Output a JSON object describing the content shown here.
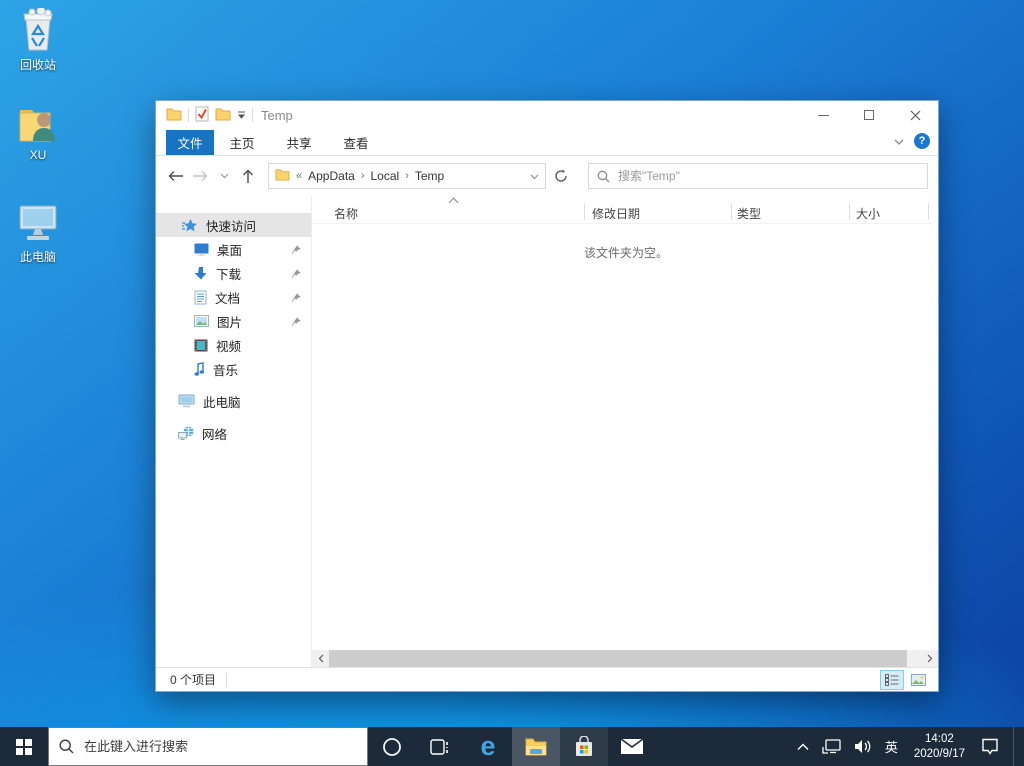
{
  "desktop": {
    "icons": [
      {
        "label": "回收站",
        "icon": "recycle-bin"
      },
      {
        "label": "XU",
        "icon": "user-folder"
      },
      {
        "label": "此电脑",
        "icon": "this-pc"
      }
    ]
  },
  "explorer": {
    "title": "Temp",
    "tabs": [
      {
        "label": "文件",
        "active": true
      },
      {
        "label": "主页",
        "active": false
      },
      {
        "label": "共享",
        "active": false
      },
      {
        "label": "查看",
        "active": false
      }
    ],
    "ribbon": {
      "help_glyph": "?"
    },
    "address": {
      "overflow_glyph": "«",
      "separator_glyph": "›",
      "crumbs": [
        "AppData",
        "Local",
        "Temp"
      ]
    },
    "search": {
      "placeholder": "搜索\"Temp\""
    },
    "nav": {
      "items": [
        {
          "label": "快速访问"
        },
        {
          "label": "桌面"
        },
        {
          "label": "下载"
        },
        {
          "label": "文档"
        },
        {
          "label": "图片"
        },
        {
          "label": "视频"
        },
        {
          "label": "音乐"
        },
        {
          "label": "此电脑"
        },
        {
          "label": "网络"
        }
      ]
    },
    "columns": [
      {
        "label": "名称"
      },
      {
        "label": "修改日期"
      },
      {
        "label": "类型"
      },
      {
        "label": "大小"
      }
    ],
    "empty_message": "该文件夹为空。",
    "status": {
      "items_count": "0 个项目"
    }
  },
  "taskbar": {
    "search": {
      "placeholder": "在此键入进行搜索"
    },
    "edge_glyph": "e",
    "tray": {
      "language": "英",
      "time": "14:02",
      "date": "2020/9/17"
    }
  },
  "colors": {
    "accent_tab": "#1873c2",
    "folder_yellow": "#fad46b",
    "taskbar_bg": "#1d2a3a",
    "desktop_top": "#2da4e6",
    "desktop_bottom": "#0c3f9e",
    "selected_view_bg": "#d5ecf9"
  }
}
